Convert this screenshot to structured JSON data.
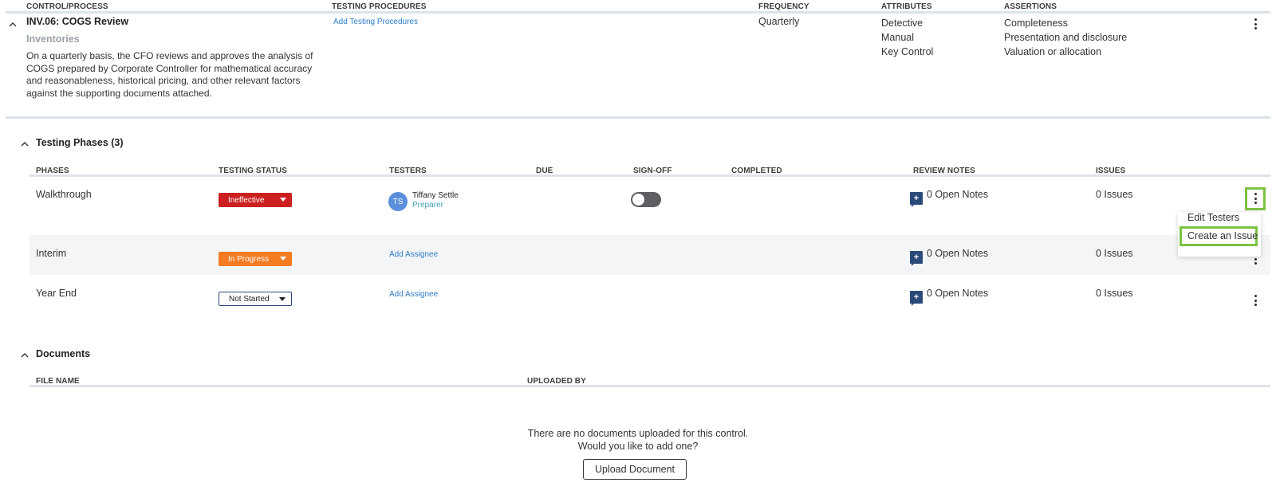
{
  "control_table": {
    "headers": [
      "CONTROL/PROCESS",
      "TESTING PROCEDURES",
      "FREQUENCY",
      "ATTRIBUTES",
      "ASSERTIONS"
    ],
    "control": {
      "title": "INV.06: COGS Review",
      "process": "Inventories",
      "description": [
        "On a quarterly basis, the CFO reviews and approves the analysis of",
        "COGS prepared by Corporate Controller for mathematical accuracy",
        "and reasonableness, historical pricing, and other relevant factors",
        "against the supporting documents attached."
      ],
      "testing_procedures_link": "Add Testing Procedures",
      "frequency": "Quarterly",
      "attributes": [
        "Detective",
        "Manual",
        "Key Control"
      ],
      "assertions": [
        "Completeness",
        "Presentation and disclosure",
        "Valuation or allocation"
      ]
    }
  },
  "testing_phases": {
    "title": "Testing Phases (3)",
    "headers": [
      "PHASES",
      "TESTING STATUS",
      "TESTERS",
      "DUE",
      "SIGN-OFF",
      "COMPLETED",
      "REVIEW NOTES",
      "ISSUES"
    ],
    "rows": [
      {
        "phase": "Walkthrough",
        "status": "Ineffective",
        "tester_initials": "TS",
        "tester_name": "Tiffany Settle",
        "tester_role": "Preparer",
        "notes": "0 Open Notes",
        "issues": "0 Issues"
      },
      {
        "phase": "Interim",
        "status": "In Progress",
        "assignee_link": "Add Assignee",
        "notes": "0 Open Notes",
        "issues": "0 Issues"
      },
      {
        "phase": "Year End",
        "status": "Not Started",
        "assignee_link": "Add Assignee",
        "notes": "0 Open Notes",
        "issues": "0 Issues"
      }
    ],
    "context_menu": {
      "items": [
        "Edit Testers",
        "Create an Issue"
      ]
    }
  },
  "documents": {
    "title": "Documents",
    "headers": [
      "FILE NAME",
      "UPLOADED BY"
    ],
    "empty_line1": "There are no documents uploaded for this control.",
    "empty_line2": "Would you like to add one?",
    "upload_button": "Upload Document"
  },
  "colors": {
    "ineffective": "#cc1f1f",
    "in_progress": "#f47b20",
    "link": "#2b7dc9",
    "highlight": "#7dc242",
    "note_icon": "#2a4a7a"
  },
  "icons": {
    "collapse": "chevron-up-icon",
    "more": "kebab-menu-icon",
    "note": "note-plus-icon",
    "dropdown": "caret-down-icon"
  }
}
